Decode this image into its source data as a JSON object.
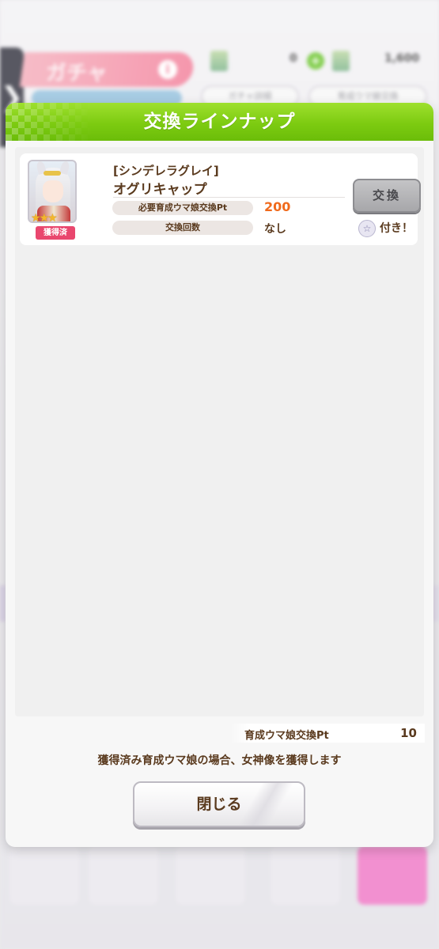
{
  "background": {
    "gacha_title": "ガチャ",
    "gacha_info": "i",
    "currency_left_value": "0",
    "currency_right_value": "1,600",
    "plus": "+",
    "pill_left": "ガチャ詳細",
    "pill_right": "育成ウマ娘交換",
    "side_handle": "❯"
  },
  "dialog": {
    "title": "交換ラインナップ",
    "item": {
      "card_title": "[シンデレラグレイ]",
      "name": "オグリキャップ",
      "stars": "★★★",
      "obtained_badge": "獲得済",
      "required_pt_label": "必要育成ウマ娘交換Pt",
      "required_pt_value": "200",
      "exchange_count_label": "交換回数",
      "exchange_count_value": "なし",
      "exchange_button": "交換",
      "bonus_icon": "☆",
      "bonus_text": "付き！"
    },
    "footer": {
      "pt_label": "育成ウマ娘交換Pt",
      "pt_value": "10",
      "note": "獲得済み育成ウマ娘の場合、女神像を獲得します",
      "close_button": "閉じる"
    }
  },
  "colors": {
    "header_green": "#7dcb11",
    "text_brown": "#5a3a1e",
    "value_orange": "#f06a1c",
    "badge_pink": "#e9476e"
  }
}
